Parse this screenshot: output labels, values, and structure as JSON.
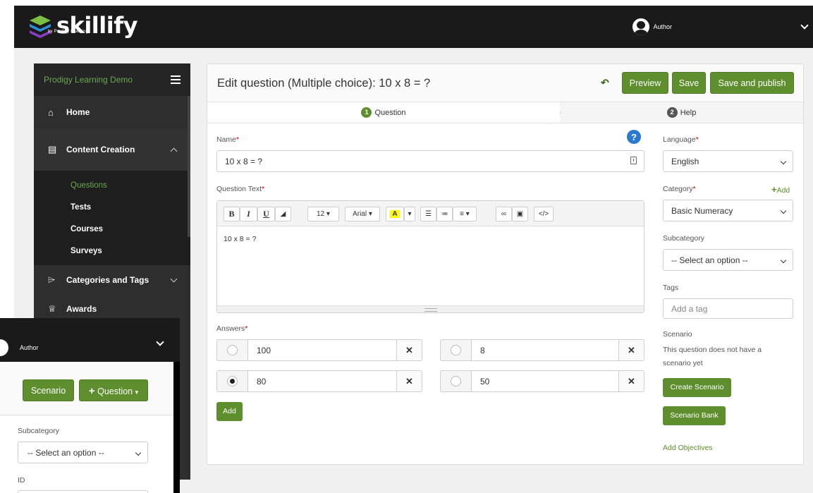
{
  "app": {
    "brand": "skillify",
    "brand_sub": "by Prodigy Learning",
    "user_name": "Author",
    "colors": {
      "accent": "#5e8e2d",
      "topbar": "#1a1a1a",
      "sidebar": "#2e2e2e",
      "help": "#2a7ad2"
    }
  },
  "sidebar": {
    "org": "Prodigy Learning Demo",
    "home": "Home",
    "content_creation": "Content Creation",
    "sub_items": [
      "Questions",
      "Tests",
      "Courses",
      "Surveys"
    ],
    "categories_tags": "Categories and Tags",
    "awards": "Awards"
  },
  "editor": {
    "title": "Edit question (Multiple choice): 10 x 8 = ?",
    "buttons": {
      "preview": "Preview",
      "save": "Save",
      "save_publish": "Save and publish"
    },
    "steps": [
      {
        "num": "1",
        "label": "Question"
      },
      {
        "num": "2",
        "label": "Help"
      }
    ],
    "name_label": "Name",
    "name_value": "10 x 8 = ?",
    "question_text_label": "Question Text",
    "toolbar": {
      "bold": "B",
      "italic": "I",
      "underline": "U",
      "font_size": "12",
      "font_family": "Arial",
      "highlight": "A",
      "code": "</>"
    },
    "question_text_value": "10 x 8 = ?",
    "answers_label": "Answers",
    "answers": [
      {
        "value": "100",
        "selected": false
      },
      {
        "value": "8",
        "selected": false
      },
      {
        "value": "80",
        "selected": true
      },
      {
        "value": "50",
        "selected": false
      }
    ],
    "add_button": "Add"
  },
  "right_panel": {
    "language_label": "Language",
    "language_value": "English",
    "category_label": "Category",
    "category_add": "Add",
    "category_value": "Basic Numeracy",
    "subcategory_label": "Subcategory",
    "subcategory_value": "-- Select an option --",
    "tags_label": "Tags",
    "tags_placeholder": "Add a tag",
    "scenario_label": "Scenario",
    "scenario_text": "This question does not have a scenario yet",
    "create_scenario": "Create Scenario",
    "scenario_bank": "Scenario Bank",
    "add_objectives": "Add Objectives"
  },
  "front_window": {
    "user_name": "Author",
    "scenario_button": "Scenario",
    "question_button": "Question",
    "subcategory_label": "Subcategory",
    "subcategory_value": "-- Select an option --",
    "id_label": "ID"
  }
}
